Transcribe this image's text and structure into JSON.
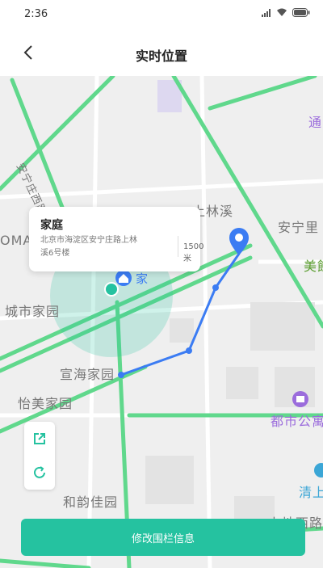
{
  "status_bar": {
    "time": "2:36"
  },
  "header": {
    "title": "实时位置",
    "back_icon": "back-arrow-icon"
  },
  "map": {
    "labels": {
      "shangling": "上林溪",
      "anningzhuang": "安宁里",
      "meiyu": "美館",
      "tong": "通",
      "chengshijiayuan": "城市家园",
      "xuanhaijiayuan": "宣海家园",
      "yimeijiayuan": "怡美家园",
      "heyunjiayuan": "和韵佳园",
      "dushi": "都市公寓",
      "qingshang": "清上",
      "shangdi": "上地西路",
      "road_name": "安宁庄西路",
      "oma": "OMA",
      "home": "家"
    },
    "colors": {
      "accent": "#25c2a0",
      "route": "#3b7cf3",
      "road": "#60d88c"
    }
  },
  "info_card": {
    "title": "家庭",
    "address": "北京市海淀区安宁庄路上林溪6号楼",
    "distance": "1500米"
  },
  "tools": {
    "expand_icon": "expand-icon",
    "refresh_icon": "refresh-icon"
  },
  "bottom_button": {
    "label": "修改围栏信息"
  }
}
